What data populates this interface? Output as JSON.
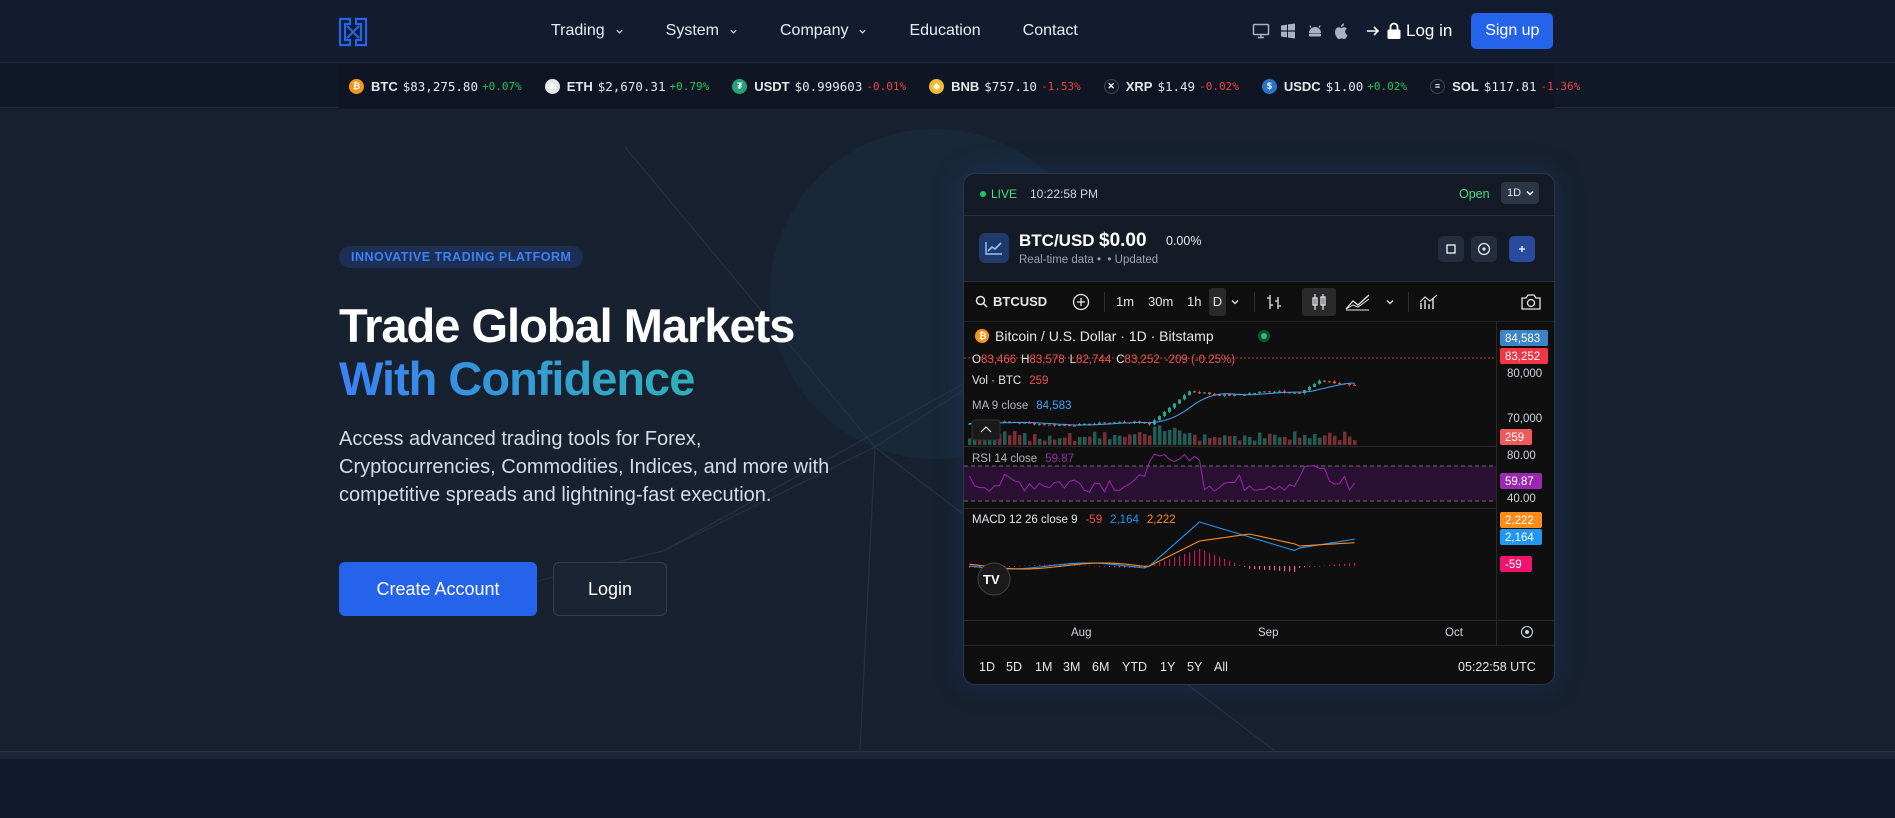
{
  "nav": {
    "menu": [
      {
        "label": "Trading",
        "dropdown": true
      },
      {
        "label": "System",
        "dropdown": true
      },
      {
        "label": "Company",
        "dropdown": true
      },
      {
        "label": "Education",
        "dropdown": false
      },
      {
        "label": "Contact",
        "dropdown": false
      }
    ],
    "platform_icons": [
      "desktop-icon",
      "windows-icon",
      "android-icon",
      "apple-icon"
    ],
    "login_label": "Log in",
    "signup_label": "Sign up"
  },
  "ticker": [
    {
      "sym": "BTC",
      "price": "$83,275.80",
      "change": "+0.07%",
      "dir": "up",
      "color": "#f7931a",
      "glyph": "₿"
    },
    {
      "sym": "ETH",
      "price": "$2,670.31",
      "change": "+0.79%",
      "dir": "up",
      "color": "#e5e7eb",
      "glyph": "◆"
    },
    {
      "sym": "USDT",
      "price": "$0.999603",
      "change": "-0.01%",
      "dir": "down",
      "color": "#26a17b",
      "glyph": "₮"
    },
    {
      "sym": "BNB",
      "price": "$757.10",
      "change": "-1.53%",
      "dir": "down",
      "color": "#f3ba2f",
      "glyph": "◈"
    },
    {
      "sym": "XRP",
      "price": "$1.49",
      "change": "-0.02%",
      "dir": "down",
      "color": "#111827",
      "glyph": "✕"
    },
    {
      "sym": "USDC",
      "price": "$1.00",
      "change": "+0.02%",
      "dir": "up",
      "color": "#2775ca",
      "glyph": "$"
    },
    {
      "sym": "SOL",
      "price": "$117.81",
      "change": "-1.36%",
      "dir": "down",
      "color": "#111827",
      "glyph": "≡"
    }
  ],
  "hero": {
    "badge": "INNOVATIVE TRADING PLATFORM",
    "title_line1": "Trade Global Markets",
    "title_line2": "With Confidence",
    "lead": "Access advanced trading tools for Forex, Cryptocurrencies, Commodities, Indices, and more with competitive spreads and lightning-fast execution.",
    "primary_cta": "Create Account",
    "secondary_cta": "Login"
  },
  "widget": {
    "live_label": "LIVE",
    "time": "10:22:58 PM",
    "status": "Open",
    "timeframe": "1D",
    "pair": "BTC/USD",
    "price": "$0.00",
    "change": "0.00%",
    "sub1": "Real-time data",
    "sub2": "Updated",
    "tv": {
      "symbol": "BTCUSD",
      "intervals": [
        "1m",
        "30m",
        "1h",
        "D"
      ],
      "legend_title": "Bitcoin / U.S. Dollar · 1D · Bitstamp",
      "ohlc": {
        "o_label": "O",
        "o": "83,466",
        "h_label": "H",
        "h": "83,578",
        "l_label": "L",
        "l": "82,744",
        "c_label": "C",
        "c": "83,252",
        "chg": "-209 (-0.25%)"
      },
      "vol_label": "Vol · BTC",
      "vol": "259",
      "ma_label": "MA 9 close",
      "ma": "84,583",
      "rsi_label": "RSI 14 close",
      "rsi": "59.87",
      "macd_label": "MACD 12 26 close 9",
      "macd_hist": "-59",
      "macd_line": "2,164",
      "macd_signal": "2,222",
      "price_axis": [
        "80,000",
        "70,000"
      ],
      "price_tags": {
        "ma": "84,583",
        "last": "83,252",
        "vol": "259"
      },
      "rsi_axis": [
        "80.00",
        "40.00"
      ],
      "rsi_tag": "59.87",
      "macd_tags": [
        "2,222",
        "2,164",
        "-59"
      ],
      "x_axis": [
        "Aug",
        "Sep",
        "Oct"
      ],
      "ranges": [
        "1D",
        "5D",
        "1M",
        "3M",
        "6M",
        "YTD",
        "1Y",
        "5Y",
        "All"
      ],
      "utc": "05:22:58 UTC"
    }
  },
  "colors": {
    "accent": "#2563eb",
    "up": "#22c55e",
    "down": "#ef4444",
    "rsi": "#9c27b0",
    "macd_line": "#2196f3",
    "macd_signal": "#ff8c1a"
  }
}
